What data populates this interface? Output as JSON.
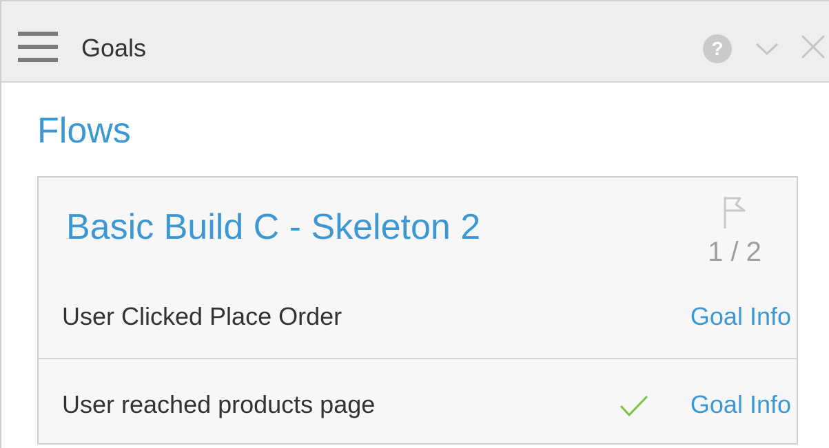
{
  "header": {
    "title": "Goals",
    "help_icon_glyph": "?",
    "icons": [
      "menu-icon",
      "help-icon",
      "chevron-down-icon",
      "close-icon"
    ]
  },
  "section": {
    "title": "Flows"
  },
  "flow": {
    "name": "Basic Build C - Skeleton 2",
    "progress": "1 / 2",
    "goals": [
      {
        "label": "User Clicked Place Order",
        "link": "Goal Info",
        "completed": false
      },
      {
        "label": "User reached products page",
        "link": "Goal Info",
        "completed": true
      }
    ]
  },
  "colors": {
    "accent": "#3d97d3",
    "check": "#7cc142",
    "header_bg": "#eeeeee",
    "card_bg": "#f7f7f7"
  }
}
